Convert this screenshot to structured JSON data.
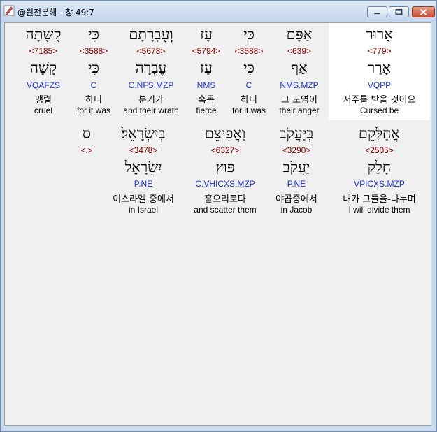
{
  "window": {
    "title": "@원전분해 - 창 49:7",
    "icon": "app-pencil-icon",
    "buttons": [
      "minimize-icon",
      "maximize-icon",
      "close-icon"
    ]
  },
  "colors": {
    "strong": "#8b0000",
    "morph": "#1f35c7",
    "highlight": "#ffffff"
  },
  "row1": [
    {
      "heb": "אָרוּר",
      "strong": "<779>",
      "root": "אָרַר",
      "morph": "VQPP",
      "kor": "저주를 받을 것이요",
      "eng": "Cursed be"
    },
    {
      "heb": "אַפָּם",
      "strong": "<639>",
      "root": "אַף",
      "morph": "NMS.MZP",
      "kor": "그 노염이",
      "eng": "their anger"
    },
    {
      "heb": "כִּי",
      "strong": "<3588>",
      "root": "כִּי",
      "morph": "C",
      "kor": "하니",
      "eng": "for it was"
    },
    {
      "heb": "עָז",
      "strong": "<5794>",
      "root": "עַז",
      "morph": "NMS",
      "kor": "혹독",
      "eng": "fierce"
    },
    {
      "heb": "וְעֶבְרָתָם",
      "strong": "<5678>",
      "root": "עֶבְרָה",
      "morph": "C.NFS.MZP",
      "kor": "분기가",
      "eng": "and their wrath"
    },
    {
      "heb": "כִּי",
      "strong": "<3588>",
      "root": "כִּי",
      "morph": "C",
      "kor": "하니",
      "eng": "for it was"
    },
    {
      "heb": "קָשָׁתָה",
      "strong": "<7185>",
      "root": "קָשָׁה",
      "morph": "VQAFZS",
      "kor": "맹렬",
      "eng": "cruel"
    }
  ],
  "row2": [
    {
      "heb": "אֲחַלְּקֵם",
      "strong": "<2505>",
      "root": "חָלַק",
      "morph": "VPICXS.MZP",
      "kor": "내가 그들을-나누며",
      "eng": "I will divide them"
    },
    {
      "heb": "בְּיַעֲקֹב",
      "strong": "<3290>",
      "root": "יַעֲקֹב",
      "morph": "P.NE",
      "kor": "야곱중에서",
      "eng": "in Jacob"
    },
    {
      "heb": "וַאֲפִיצֵם",
      "strong": "<6327>",
      "root": "פּוּץ",
      "morph": "C.VHICXS.MZP",
      "kor": "흩으리로다",
      "eng": "and scatter them"
    },
    {
      "heb": "בְּיִשְׂרָאֵל׃",
      "strong": "<3478>",
      "root": "יִשְׂרָאֵל",
      "morph": "P.NE",
      "kor": "이스라엘 중에서",
      "eng": "in Israel"
    },
    {
      "heb": "ס",
      "strong": "<.>",
      "root": "",
      "morph": "",
      "kor": "",
      "eng": ""
    }
  ]
}
